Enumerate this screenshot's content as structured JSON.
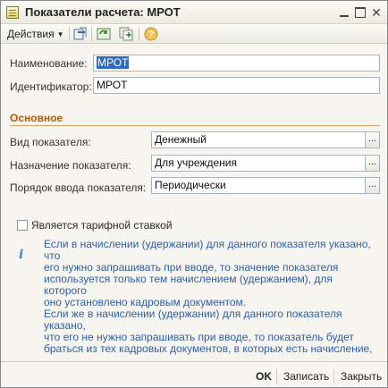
{
  "window": {
    "title": "Показатели расчета: МРОТ",
    "controls": [
      "minimize",
      "maximize",
      "close"
    ]
  },
  "toolbar": {
    "actions_label": "Действия",
    "icons": [
      "new-icon",
      "refresh-icon",
      "copy-icon",
      "help-icon"
    ]
  },
  "form": {
    "name_label": "Наименование:",
    "name_value": "МРОТ",
    "id_label": "Идентификатор:",
    "id_value": "МРОТ",
    "section_title": "Основное",
    "indicator_type_label": "Вид показателя:",
    "indicator_type_value": "Денежный",
    "indicator_purpose_label": "Назначение показателя:",
    "indicator_purpose_value": "Для учреждения",
    "input_order_label": "Порядок ввода показателя:",
    "input_order_value": "Периодически",
    "tariff_checkbox_label": "Является тарифной ставкой",
    "tariff_checked": false,
    "button_ellipsis": "..."
  },
  "info": {
    "lines": [
      "Если в начислении (удержании) для данного показателя указано, что",
      "его нужно запрашивать при вводе, то значение показателя",
      "используется только тем начислением (удержанием), для которого",
      "оно установлено кадровым документом.",
      "Если же в начислении (удержании) для данного показателя указано,",
      "что его не нужно запрашивать при вводе, то показатель будет",
      "браться из тех кадровых документов, в которых есть начисление,"
    ]
  },
  "bottom": {
    "ok_label": "OK",
    "save_label": "Записать",
    "close_label": "Закрыть"
  },
  "colors": {
    "section_title": "#b35a09",
    "info_text": "#2f5ea8",
    "selection": "#316ac5"
  }
}
